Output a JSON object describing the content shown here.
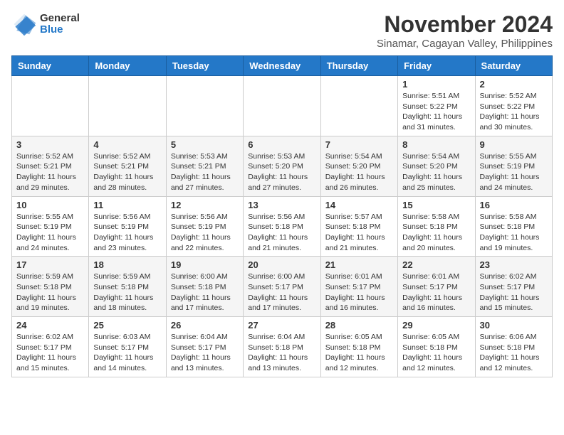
{
  "logo": {
    "general": "General",
    "blue": "Blue"
  },
  "title": "November 2024",
  "subtitle": "Sinamar, Cagayan Valley, Philippines",
  "days_header": [
    "Sunday",
    "Monday",
    "Tuesday",
    "Wednesday",
    "Thursday",
    "Friday",
    "Saturday"
  ],
  "weeks": [
    [
      {
        "day": "",
        "info": ""
      },
      {
        "day": "",
        "info": ""
      },
      {
        "day": "",
        "info": ""
      },
      {
        "day": "",
        "info": ""
      },
      {
        "day": "",
        "info": ""
      },
      {
        "day": "1",
        "info": "Sunrise: 5:51 AM\nSunset: 5:22 PM\nDaylight: 11 hours\nand 31 minutes."
      },
      {
        "day": "2",
        "info": "Sunrise: 5:52 AM\nSunset: 5:22 PM\nDaylight: 11 hours\nand 30 minutes."
      }
    ],
    [
      {
        "day": "3",
        "info": "Sunrise: 5:52 AM\nSunset: 5:21 PM\nDaylight: 11 hours\nand 29 minutes."
      },
      {
        "day": "4",
        "info": "Sunrise: 5:52 AM\nSunset: 5:21 PM\nDaylight: 11 hours\nand 28 minutes."
      },
      {
        "day": "5",
        "info": "Sunrise: 5:53 AM\nSunset: 5:21 PM\nDaylight: 11 hours\nand 27 minutes."
      },
      {
        "day": "6",
        "info": "Sunrise: 5:53 AM\nSunset: 5:20 PM\nDaylight: 11 hours\nand 27 minutes."
      },
      {
        "day": "7",
        "info": "Sunrise: 5:54 AM\nSunset: 5:20 PM\nDaylight: 11 hours\nand 26 minutes."
      },
      {
        "day": "8",
        "info": "Sunrise: 5:54 AM\nSunset: 5:20 PM\nDaylight: 11 hours\nand 25 minutes."
      },
      {
        "day": "9",
        "info": "Sunrise: 5:55 AM\nSunset: 5:19 PM\nDaylight: 11 hours\nand 24 minutes."
      }
    ],
    [
      {
        "day": "10",
        "info": "Sunrise: 5:55 AM\nSunset: 5:19 PM\nDaylight: 11 hours\nand 24 minutes."
      },
      {
        "day": "11",
        "info": "Sunrise: 5:56 AM\nSunset: 5:19 PM\nDaylight: 11 hours\nand 23 minutes."
      },
      {
        "day": "12",
        "info": "Sunrise: 5:56 AM\nSunset: 5:19 PM\nDaylight: 11 hours\nand 22 minutes."
      },
      {
        "day": "13",
        "info": "Sunrise: 5:56 AM\nSunset: 5:18 PM\nDaylight: 11 hours\nand 21 minutes."
      },
      {
        "day": "14",
        "info": "Sunrise: 5:57 AM\nSunset: 5:18 PM\nDaylight: 11 hours\nand 21 minutes."
      },
      {
        "day": "15",
        "info": "Sunrise: 5:58 AM\nSunset: 5:18 PM\nDaylight: 11 hours\nand 20 minutes."
      },
      {
        "day": "16",
        "info": "Sunrise: 5:58 AM\nSunset: 5:18 PM\nDaylight: 11 hours\nand 19 minutes."
      }
    ],
    [
      {
        "day": "17",
        "info": "Sunrise: 5:59 AM\nSunset: 5:18 PM\nDaylight: 11 hours\nand 19 minutes."
      },
      {
        "day": "18",
        "info": "Sunrise: 5:59 AM\nSunset: 5:18 PM\nDaylight: 11 hours\nand 18 minutes."
      },
      {
        "day": "19",
        "info": "Sunrise: 6:00 AM\nSunset: 5:18 PM\nDaylight: 11 hours\nand 17 minutes."
      },
      {
        "day": "20",
        "info": "Sunrise: 6:00 AM\nSunset: 5:17 PM\nDaylight: 11 hours\nand 17 minutes."
      },
      {
        "day": "21",
        "info": "Sunrise: 6:01 AM\nSunset: 5:17 PM\nDaylight: 11 hours\nand 16 minutes."
      },
      {
        "day": "22",
        "info": "Sunrise: 6:01 AM\nSunset: 5:17 PM\nDaylight: 11 hours\nand 16 minutes."
      },
      {
        "day": "23",
        "info": "Sunrise: 6:02 AM\nSunset: 5:17 PM\nDaylight: 11 hours\nand 15 minutes."
      }
    ],
    [
      {
        "day": "24",
        "info": "Sunrise: 6:02 AM\nSunset: 5:17 PM\nDaylight: 11 hours\nand 15 minutes."
      },
      {
        "day": "25",
        "info": "Sunrise: 6:03 AM\nSunset: 5:17 PM\nDaylight: 11 hours\nand 14 minutes."
      },
      {
        "day": "26",
        "info": "Sunrise: 6:04 AM\nSunset: 5:17 PM\nDaylight: 11 hours\nand 13 minutes."
      },
      {
        "day": "27",
        "info": "Sunrise: 6:04 AM\nSunset: 5:18 PM\nDaylight: 11 hours\nand 13 minutes."
      },
      {
        "day": "28",
        "info": "Sunrise: 6:05 AM\nSunset: 5:18 PM\nDaylight: 11 hours\nand 12 minutes."
      },
      {
        "day": "29",
        "info": "Sunrise: 6:05 AM\nSunset: 5:18 PM\nDaylight: 11 hours\nand 12 minutes."
      },
      {
        "day": "30",
        "info": "Sunrise: 6:06 AM\nSunset: 5:18 PM\nDaylight: 11 hours\nand 12 minutes."
      }
    ]
  ]
}
